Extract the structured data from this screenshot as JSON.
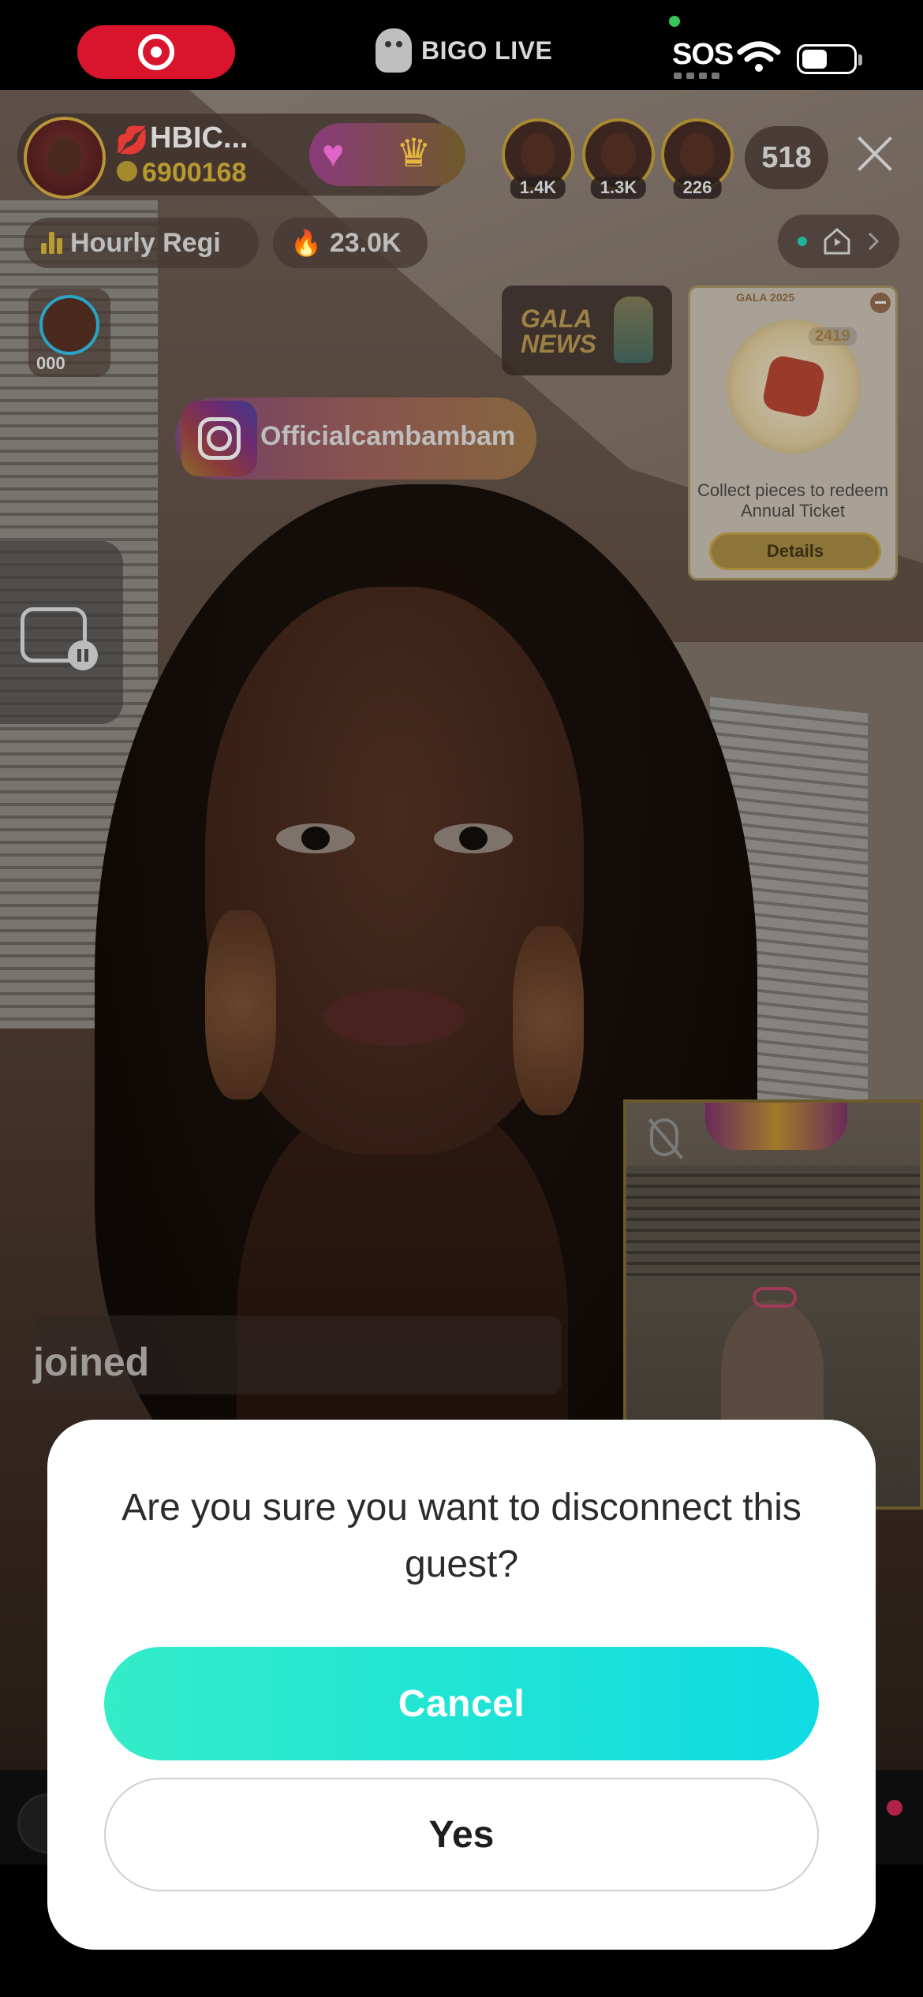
{
  "status_bar": {
    "brand": "BIGO LIVE",
    "sos": "SOS"
  },
  "host": {
    "name": "HBIC...",
    "coins": "6900168"
  },
  "top_viewers": [
    {
      "count": "1.4K"
    },
    {
      "count": "1.3K"
    },
    {
      "count": "226"
    }
  ],
  "viewer_total": "518",
  "pills": {
    "hourly": "Hourly Regi",
    "score": "23.0K"
  },
  "level_badge": "000",
  "gala_news": {
    "line1": "GALA",
    "line2": "NEWS"
  },
  "event_card": {
    "year": "GALA 2025",
    "count": "2419",
    "text": "Collect pieces to redeem Annual Ticket",
    "button": "Details"
  },
  "instagram": "Officialcambambam",
  "chat": {
    "joined": "joined"
  },
  "dialog": {
    "message": "Are you sure you want to disconnect this guest?",
    "cancel_label": "Cancel",
    "yes_label": "Yes",
    "cancel_color": "#1fe3d6"
  }
}
